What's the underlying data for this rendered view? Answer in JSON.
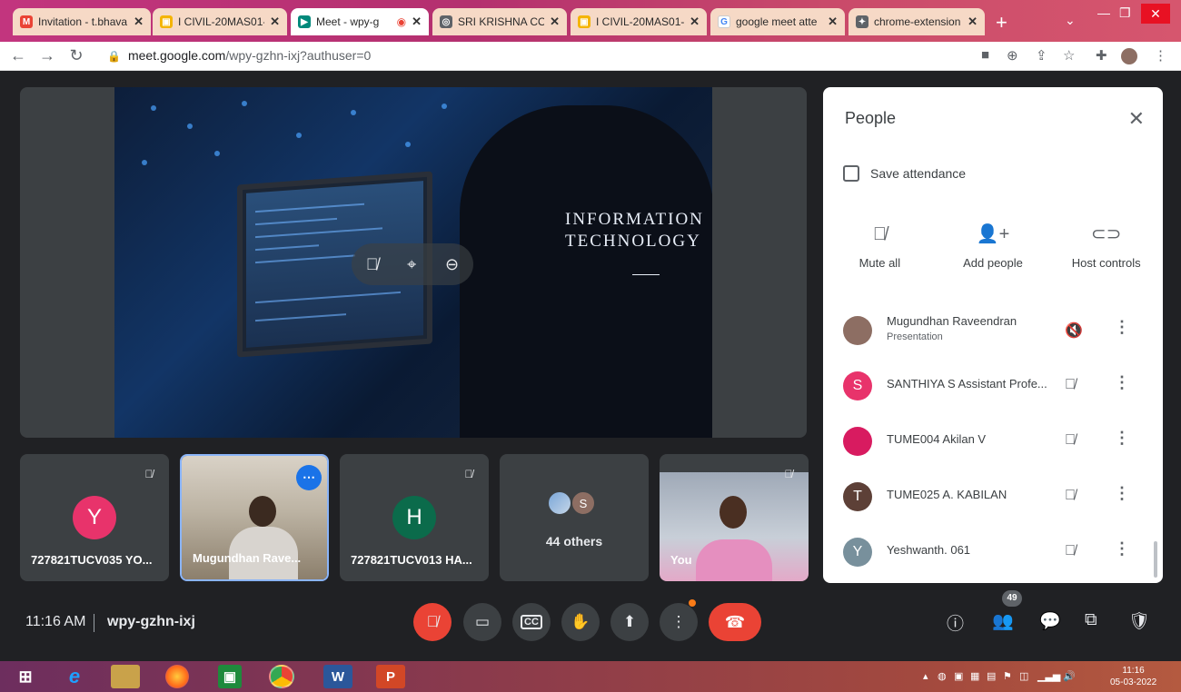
{
  "browser": {
    "tabs": [
      {
        "label": "Invitation - t.bhava",
        "favicon": "gmail-icon",
        "color": "#ea4335",
        "active": false
      },
      {
        "label": "I CIVIL-20MAS01-",
        "favicon": "classroom-icon",
        "color": "#f4b400",
        "active": false
      },
      {
        "label": "Meet - wpy-g",
        "favicon": "meet-icon",
        "color": "#00897b",
        "active": true
      },
      {
        "label": "SRI KRISHNA COL",
        "favicon": "site-icon",
        "color": "#5f6368",
        "active": false
      },
      {
        "label": "I CIVIL-20MAS01-",
        "favicon": "classroom-icon",
        "color": "#f4b400",
        "active": false
      },
      {
        "label": "google meet atte",
        "favicon": "google-icon",
        "color": "#4285f4",
        "active": false
      },
      {
        "label": "chrome-extension",
        "favicon": "extension-icon",
        "color": "#5f6368",
        "active": false
      }
    ],
    "url_host": "meet.google.com",
    "url_path": "/wpy-gzhn-ixj?authuser=0"
  },
  "presentation": {
    "title_line1": "INFORMATION",
    "title_line2": "TECHNOLOGY"
  },
  "tiles": [
    {
      "name": "727821TUCV035 YO...",
      "initial": "Y",
      "color": "#e8336b"
    },
    {
      "name": "Mugundhan Rave..."
    },
    {
      "name": "727821TUCV013 HA...",
      "initial": "H",
      "color": "#0b6b4b"
    },
    {
      "others_label": "44 others",
      "initial": "S"
    },
    {
      "name": "You"
    }
  ],
  "people_panel": {
    "title": "People",
    "save_attendance": "Save attendance",
    "actions": [
      {
        "label": "Mute all",
        "icon": "mic-off-icon"
      },
      {
        "label": "Add people",
        "icon": "person-add-icon"
      },
      {
        "label": "Host controls",
        "icon": "toggle-icon"
      }
    ],
    "participants": [
      {
        "name": "Mugundhan Raveendran",
        "sub": "Presentation",
        "initial": "",
        "color": "#8d6e63",
        "mic": "speaker-off-icon"
      },
      {
        "name": "SANTHIYA S Assistant Profe...",
        "sub": "",
        "initial": "S",
        "color": "#e8336b",
        "mic": "mic-off-icon"
      },
      {
        "name": "TUME004 Akilan V",
        "sub": "",
        "initial": "",
        "color": "#d81b60",
        "mic": "mic-off-icon"
      },
      {
        "name": "TUME025 A. KABILAN",
        "sub": "",
        "initial": "T",
        "color": "#5d4037",
        "mic": "mic-off-icon"
      },
      {
        "name": "Yeshwanth. 061",
        "sub": "",
        "initial": "Y",
        "color": "#78909c",
        "mic": "mic-off-icon"
      }
    ]
  },
  "bottom": {
    "time": "11:16 AM",
    "meeting_code": "wpy-gzhn-ixj",
    "people_count": "49"
  },
  "taskbar": {
    "clock_time": "11:16",
    "clock_date": "05-03-2022"
  }
}
